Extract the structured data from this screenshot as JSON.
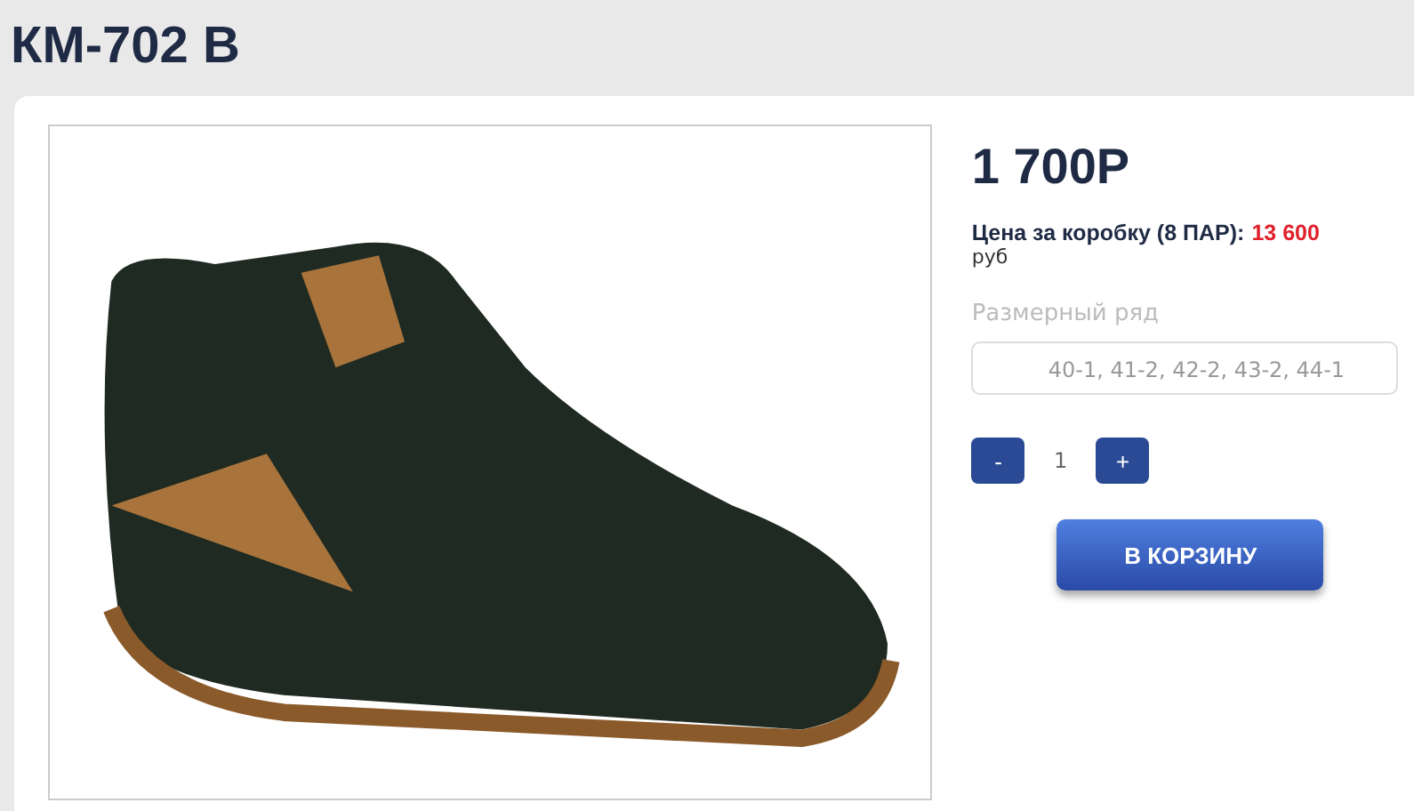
{
  "title": "КМ-702 В",
  "product": {
    "price": "1 700Р",
    "box_price_label": "Цена за коробку (8 ПАР):",
    "box_price_value": "13 600",
    "currency": "руб",
    "sizes_label": "Размерный ряд",
    "sizes_value": "40-1, 41-2, 42-2, 43-2, 44-1",
    "quantity": {
      "minus": "-",
      "value": "1",
      "plus": "+"
    },
    "cart_button": "В КОРЗИНУ"
  }
}
